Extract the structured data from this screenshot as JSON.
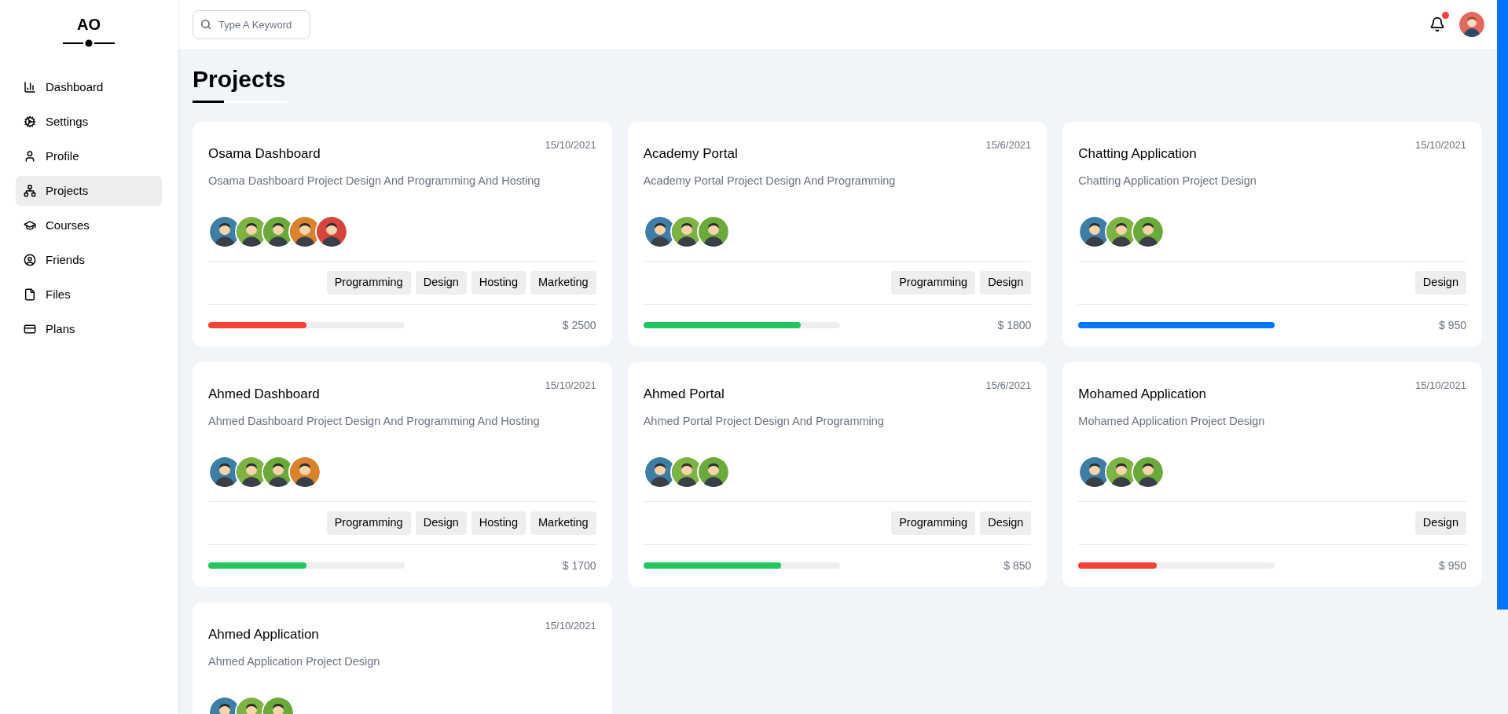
{
  "logo": {
    "text": "AO"
  },
  "sidebar": {
    "items": [
      {
        "label": "Dashboard",
        "kind": "chart",
        "selected": false
      },
      {
        "label": "Settings",
        "kind": "gears",
        "selected": false
      },
      {
        "label": "Profile",
        "kind": "user",
        "selected": false
      },
      {
        "label": "Projects",
        "kind": "nodes",
        "selected": true
      },
      {
        "label": "Courses",
        "kind": "cap",
        "selected": false
      },
      {
        "label": "Friends",
        "kind": "circle-user",
        "selected": false
      },
      {
        "label": "Files",
        "kind": "file",
        "selected": false
      },
      {
        "label": "Plans",
        "kind": "card",
        "selected": false
      }
    ]
  },
  "header": {
    "search": {
      "placeholder": "Type A Keyword"
    },
    "notifications": {
      "unread": true
    }
  },
  "page": {
    "title": "Projects"
  },
  "projects": [
    {
      "title": "Osama Dashboard",
      "date": "15/10/2021",
      "description": "Osama Dashboard Project Design And Programming And Hosting",
      "avatars": [
        {
          "color": "#3d7ea6"
        },
        {
          "color": "#7cb342"
        },
        {
          "color": "#6aaa3a"
        },
        {
          "color": "#d9822b"
        },
        {
          "color": "#d6453d"
        }
      ],
      "tags": [
        "Programming",
        "Design",
        "Hosting",
        "Marketing"
      ],
      "level": 0.5,
      "color": "#f44336",
      "price": "$ 2500"
    },
    {
      "title": "Academy Portal",
      "date": "15/6/2021",
      "description": "Academy Portal Project Design And Programming",
      "avatars": [
        {
          "color": "#3d7ea6"
        },
        {
          "color": "#7cb342"
        },
        {
          "color": "#6aaa3a"
        }
      ],
      "tags": [
        "Programming",
        "Design"
      ],
      "level": 0.8,
      "color": "#22c55e",
      "price": "$ 1800"
    },
    {
      "title": "Chatting Application",
      "date": "15/10/2021",
      "description": "Chatting Application Project Design",
      "avatars": [
        {
          "color": "#3d7ea6"
        },
        {
          "color": "#7cb342"
        },
        {
          "color": "#6aaa3a"
        }
      ],
      "tags": [
        "Design"
      ],
      "level": 1,
      "color": "#0075ff",
      "price": "$ 950"
    },
    {
      "title": "Ahmed Dashboard",
      "date": "15/10/2021",
      "description": "Ahmed Dashboard Project Design And Programming And Hosting",
      "avatars": [
        {
          "color": "#3d7ea6"
        },
        {
          "color": "#7cb342"
        },
        {
          "color": "#6aaa3a"
        },
        {
          "color": "#d9822b"
        }
      ],
      "tags": [
        "Programming",
        "Design",
        "Hosting",
        "Marketing"
      ],
      "level": 0.5,
      "color": "#22c55e",
      "price": "$ 1700"
    },
    {
      "title": "Ahmed Portal",
      "date": "15/6/2021",
      "description": "Ahmed Portal Project Design And Programming",
      "avatars": [
        {
          "color": "#3d7ea6"
        },
        {
          "color": "#7cb342"
        },
        {
          "color": "#6aaa3a"
        }
      ],
      "tags": [
        "Programming",
        "Design"
      ],
      "level": 0.7,
      "color": "#22c55e",
      "price": "$ 850"
    },
    {
      "title": "Mohamed Application",
      "date": "15/10/2021",
      "description": "Mohamed Application Project Design",
      "avatars": [
        {
          "color": "#3d7ea6"
        },
        {
          "color": "#7cb342"
        },
        {
          "color": "#6aaa3a"
        }
      ],
      "tags": [
        "Design"
      ],
      "level": 0.4,
      "color": "#f44336",
      "price": "$ 950"
    },
    {
      "title": "Ahmed Application",
      "date": "15/10/2021",
      "description": "Ahmed Application Project Design",
      "avatars": [
        {
          "color": "#3d7ea6"
        },
        {
          "color": "#7cb342"
        },
        {
          "color": "#6aaa3a"
        }
      ]
    }
  ]
}
